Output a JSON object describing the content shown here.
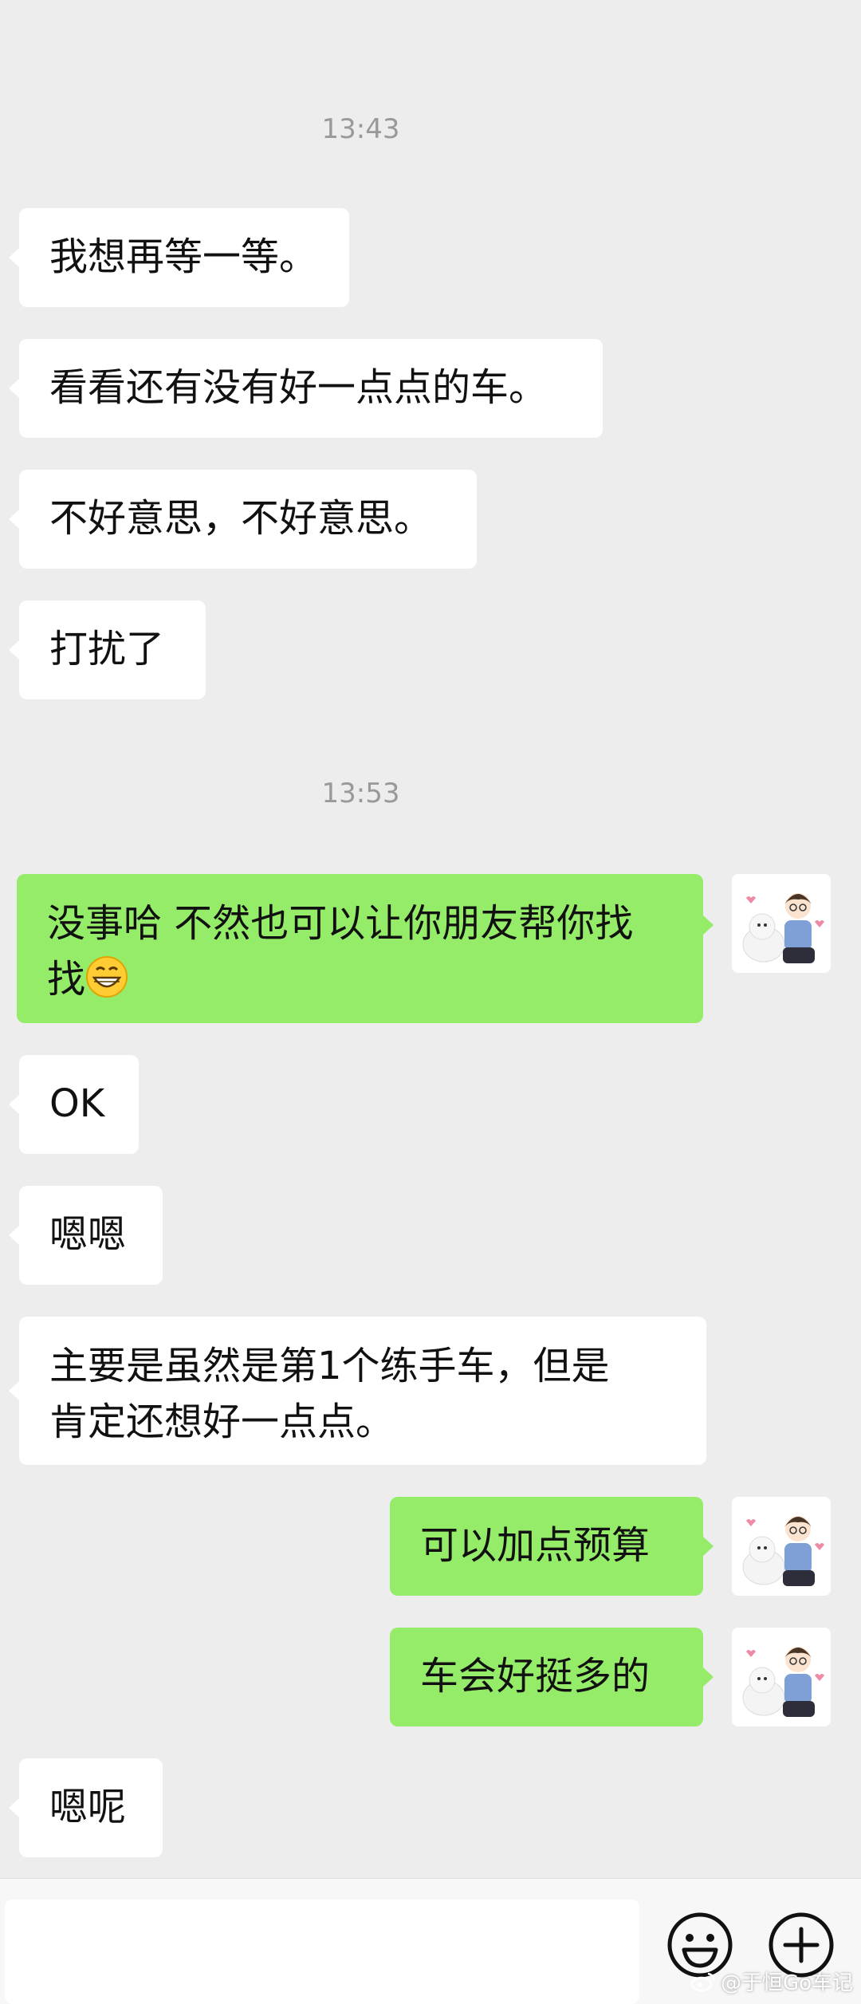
{
  "chat": {
    "timestamps": [
      "13:43",
      "13:53"
    ],
    "messages": [
      {
        "side": "in",
        "text": "我想再等一等。"
      },
      {
        "side": "in",
        "text": "看看还有没有好一点点的车。"
      },
      {
        "side": "in",
        "text": "不好意思，不好意思。"
      },
      {
        "side": "in",
        "text": "打扰了"
      },
      {
        "side": "out",
        "text": "没事哈 不然也可以让你朋友帮你找",
        "text2": "找",
        "emoji": "grinning-face-emoji"
      },
      {
        "side": "in",
        "text": "OK"
      },
      {
        "side": "in",
        "text": "嗯嗯"
      },
      {
        "side": "in",
        "text": "主要是虽然是第1个练手车，但是",
        "text2": "肯定还想好一点点。"
      },
      {
        "side": "out",
        "text": "可以加点预算"
      },
      {
        "side": "out",
        "text": "车会好挺多的"
      },
      {
        "side": "in",
        "text": "嗯呢"
      }
    ]
  },
  "bottom_bar": {
    "input_placeholder": "",
    "emoji_button_icon": "smiley-icon",
    "plus_button_icon": "plus-circle-icon"
  },
  "watermark": {
    "text": "@于恒Go车记",
    "icon": "weibo-icon"
  },
  "colors": {
    "background": "#ededed",
    "incoming_bubble": "#ffffff",
    "outgoing_bubble": "#95ec69",
    "timestamp_text": "#999999"
  }
}
